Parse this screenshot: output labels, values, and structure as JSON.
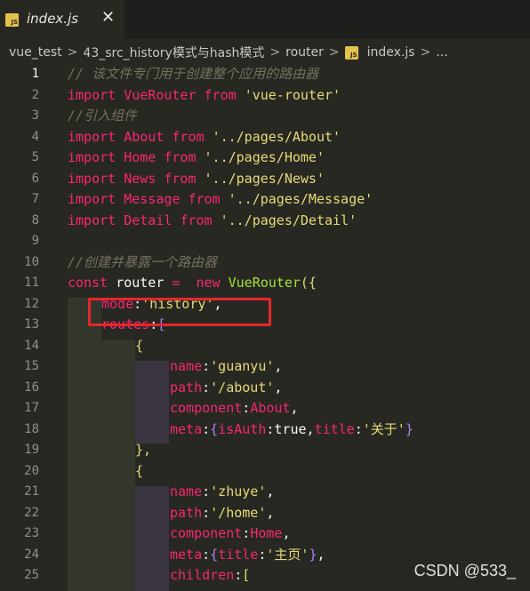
{
  "tab": {
    "title": "index.js",
    "close": "✕",
    "badge": "JS"
  },
  "breadcrumb": {
    "items": [
      "vue_test",
      "43_src_history模式与hash模式",
      "router"
    ],
    "file": "index.js",
    "more": "...",
    "separator": ">"
  },
  "editor": {
    "line_numbers": [
      "1",
      "2",
      "3",
      "4",
      "5",
      "6",
      "7",
      "8",
      "9",
      "10",
      "11",
      "12",
      "13",
      "14",
      "15",
      "16",
      "17",
      "18",
      "19",
      "20",
      "21",
      "22",
      "23",
      "24",
      "25"
    ]
  },
  "code": {
    "l1": {
      "comment": "// 该文件专门用于创建整个应用的路由器"
    },
    "l2": {
      "kw1": "import",
      "name": "VueRouter",
      "kw2": "from",
      "str": "'vue-router'"
    },
    "l3": {
      "comment": "//引入组件"
    },
    "l4": {
      "kw1": "import",
      "name": "About",
      "kw2": "from",
      "str": "'../pages/About'"
    },
    "l5": {
      "kw1": "import",
      "name": "Home",
      "kw2": "from",
      "str": "'../pages/Home'"
    },
    "l6": {
      "kw1": "import",
      "name": "News",
      "kw2": "from",
      "str": "'../pages/News'"
    },
    "l7": {
      "kw1": "import",
      "name": "Message",
      "kw2": "from",
      "str": "'../pages/Message'"
    },
    "l8": {
      "kw1": "import",
      "name": "Detail",
      "kw2": "from",
      "str": "'../pages/Detail'"
    },
    "l10": {
      "comment": "//创建并暴露一个路由器"
    },
    "l11": {
      "kw": "const",
      "name": "router",
      "op": "=",
      "kw2": "new",
      "cls": "VueRouter",
      "paren": "({"
    },
    "l12": {
      "key": "mode",
      "str": "'history'",
      "punct": ","
    },
    "l13": {
      "key": "routes",
      "bracket": "["
    },
    "l14": {
      "brace": "{"
    },
    "l15": {
      "key": "name",
      "str": "'guanyu'"
    },
    "l16": {
      "key": "path",
      "str": "'/about'"
    },
    "l17": {
      "key": "component",
      "val": "About"
    },
    "l18": {
      "key": "meta",
      "k1": "isAuth",
      "v1": "true",
      "k2": "title",
      "v2": "'关于'"
    },
    "l19": {
      "brace": "},"
    },
    "l20": {
      "brace": "{"
    },
    "l21": {
      "key": "name",
      "str": "'zhuye'"
    },
    "l22": {
      "key": "path",
      "str": "'/home'"
    },
    "l23": {
      "key": "component",
      "val": "Home"
    },
    "l24": {
      "key": "meta",
      "k": "title",
      "v": "'主页'"
    },
    "l25": {
      "key": "children",
      "bracket": "["
    }
  },
  "watermark": "CSDN @533_",
  "colors": {
    "background": "#272822",
    "keyword": "#f92672",
    "string": "#e6db74",
    "comment": "#75715e",
    "class": "#a6e22e",
    "constant": "#ae81ff",
    "highlight": "#e8262c"
  }
}
